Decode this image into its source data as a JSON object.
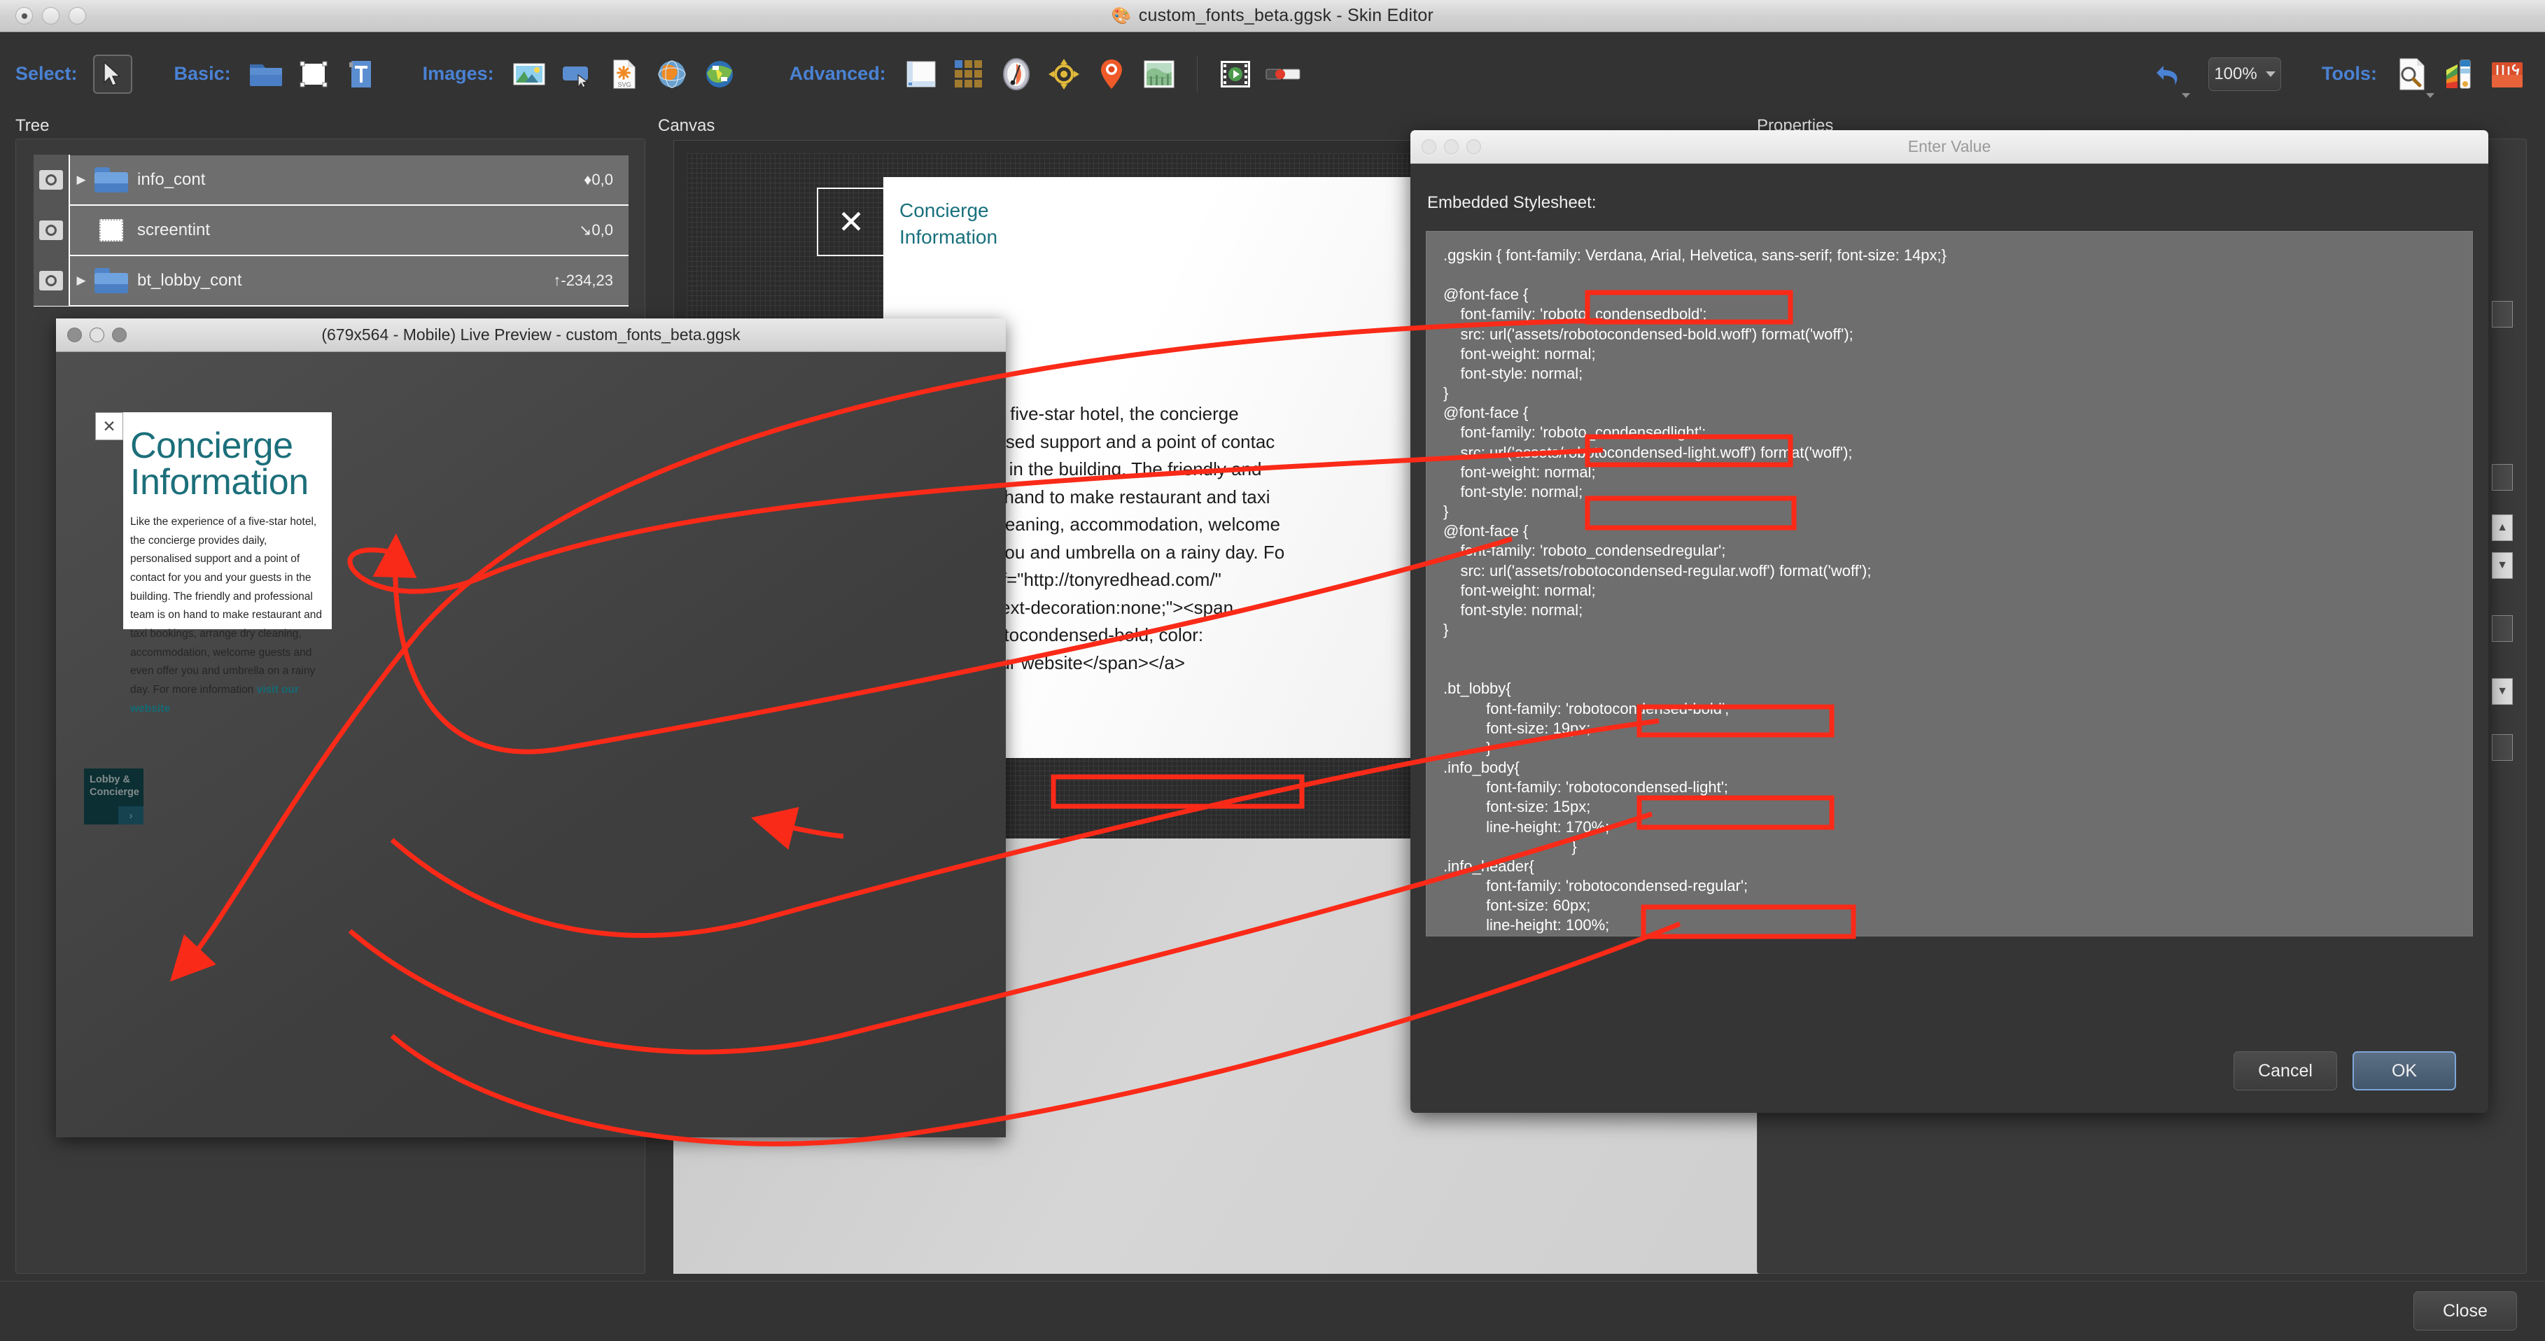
{
  "window": {
    "title": "custom_fonts_beta.ggsk - Skin Editor",
    "title_icon": "app-icon"
  },
  "toolbar": {
    "groups": [
      {
        "label": "Select:",
        "items": [
          {
            "icon": "cursor-arrow-icon",
            "selected": true
          }
        ]
      },
      {
        "label": "Basic:",
        "items": [
          {
            "icon": "folder-icon"
          },
          {
            "icon": "rectangle-icon"
          },
          {
            "icon": "text-icon"
          }
        ]
      },
      {
        "label": "Images:",
        "items": [
          {
            "icon": "image-icon"
          },
          {
            "icon": "button-icon"
          },
          {
            "icon": "svg-file-icon"
          },
          {
            "icon": "globe-icon"
          },
          {
            "icon": "map-icon"
          }
        ]
      },
      {
        "label": "Advanced:",
        "items": [
          {
            "icon": "viewer-icon"
          },
          {
            "icon": "thumbnail-grid-icon"
          },
          {
            "icon": "compass-icon"
          },
          {
            "icon": "radar-icon"
          },
          {
            "icon": "map-pin-icon"
          },
          {
            "icon": "world-map-icon"
          },
          {
            "icon": "video-icon"
          },
          {
            "icon": "progress-bar-icon"
          }
        ]
      }
    ],
    "undo_icon": "undo-arrow-icon",
    "zoom_value": "100%",
    "tools_label": "Tools:",
    "tools_items": [
      {
        "icon": "inspect-document-icon"
      },
      {
        "icon": "color-palette-icon"
      },
      {
        "icon": "toolbox-icon"
      }
    ]
  },
  "panels": {
    "tree_label": "Tree",
    "canvas_label": "Canvas",
    "properties_label": "Properties"
  },
  "tree": {
    "rows": [
      {
        "name": "info_cont",
        "coord": "0,0",
        "coord_glyph": "♦",
        "icon": "folder-icon",
        "expandable": true,
        "eye": "visibility-icon"
      },
      {
        "name": "screentint",
        "coord": "0,0",
        "coord_glyph": "↘",
        "icon": "rectangle-icon",
        "expandable": false,
        "eye": "visibility-icon"
      },
      {
        "name": "bt_lobby_cont",
        "coord": "-234,23",
        "coord_glyph": "↑",
        "icon": "folder-icon",
        "expandable": true,
        "eye": "visibility-icon"
      }
    ]
  },
  "canvas": {
    "close_glyph": "✕",
    "card_title": "Concierge\nInformation",
    "card_body": "erience of a five-star hotel, the concierge\nly, personalised support and a point of contac\nyour guests in the building. The friendly and\n team is on hand to make restaurant and taxi\nrange dry cleaning, accommodation, welcome\neven offer you and umbrella on a rainy day. Fo\nation<a href=\"http://tonyredhead.com/\"\nnk\" style=\"text-decoration:none;\"><span\nfamily: robotocondensed-bold; color:\n0);\"> visit our website</span></a>"
  },
  "live_preview": {
    "title": "(679x564 - Mobile) Live Preview - custom_fonts_beta.ggsk",
    "close_glyph": "✕",
    "heading": "Concierge Information",
    "body_text": "Like the experience of a five-star hotel, the concierge provides daily, personalised support and a point of contact for you and your guests in the building. The friendly and professional team is on hand to make restaurant and taxi bookings, arrange dry cleaning, accommodation, welcome guests and even offer you and umbrella on a rainy day. For more information ",
    "link_text": "visit our website",
    "lobby_button_label": "Lobby & Concierge",
    "lobby_chevron": "›",
    "heading_color": "#1b6f7a",
    "link_color": "#156a74",
    "lobby_bg_color": "#0b2f33"
  },
  "dialog": {
    "title": "Enter Value",
    "caption": "Embedded Stylesheet:",
    "stylesheet": ".ggskin { font-family: Verdana, Arial, Helvetica, sans-serif; font-size: 14px;}\n\n@font-face {\n    font-family: 'roboto_condensedbold';\n    src: url('assets/robotocondensed-bold.woff') format('woff');\n    font-weight: normal;\n    font-style: normal;\n}\n@font-face {\n    font-family: 'roboto_condensedlight';\n    src: url('assets/robotocondensed-light.woff') format('woff');\n    font-weight: normal;\n    font-style: normal;\n}\n@font-face {\n    font-family: 'roboto_condensedregular';\n    src: url('assets/robotocondensed-regular.woff') format('woff');\n    font-weight: normal;\n    font-style: normal;\n}\n\n\n.bt_lobby{\n          font-family: 'robotocondensed-bold';\n          font-size: 19px;\n          }\n.info_body{\n          font-family: 'robotocondensed-light';\n          font-size: 15px;\n          line-height: 170%;\n                              }\n.info_header{\n          font-family: 'robotocondensed-regular';\n          font-size: 60px;\n          line-height: 100%;\n                              }",
    "cancel_label": "Cancel",
    "ok_label": "OK"
  },
  "footer": {
    "close_label": "Close"
  },
  "annotations": {
    "color": "#fa2a18",
    "highlight_boxes": [
      "robotocondensed-bold.woff src path",
      "robotocondensed-light.woff src path",
      "roboto_condensedregular font-family",
      ".bt_lobby font-family robotocondensed-bold",
      ".info_body font-family robotocondensed-light",
      ".info_header font-family robotocondensed-regular",
      "canvas inline span font-family robotocondensed-bold"
    ]
  }
}
